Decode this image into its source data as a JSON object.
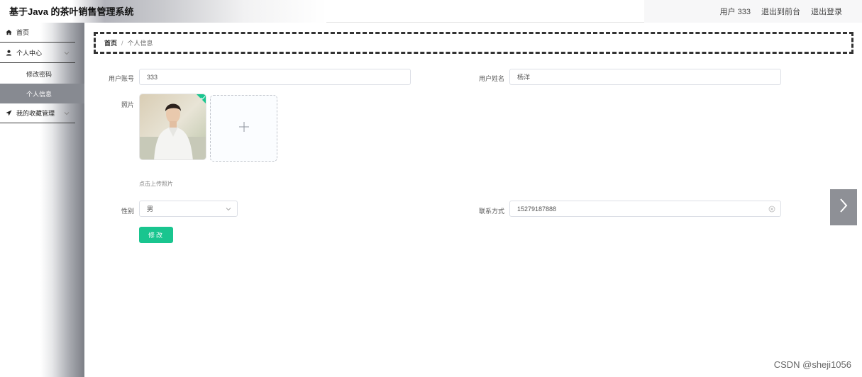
{
  "header": {
    "title": "基于Java 的茶叶销售管理系统",
    "user": "用户 333",
    "back_to_front": "退出到前台",
    "logout": "退出登录"
  },
  "sidebar": {
    "home": "首页",
    "personal_center": "个人中心",
    "change_password": "修改密码",
    "personal_info": "个人信息",
    "favorites": "我的收藏管理"
  },
  "breadcrumb": {
    "home": "首页",
    "separator": "/",
    "current": "个人信息"
  },
  "form": {
    "account_label": "用户账号",
    "account_value": "333",
    "name_label": "用户姓名",
    "name_value": "杨洋",
    "photo_label": "照片",
    "upload_hint": "点击上传照片",
    "gender_label": "性别",
    "gender_value": "男",
    "contact_label": "联系方式",
    "contact_value": "15279187888",
    "submit": "修改"
  },
  "watermark": "CSDN @sheji1056",
  "colors": {
    "primary": "#19c58f",
    "active_menu": "#878a91"
  }
}
